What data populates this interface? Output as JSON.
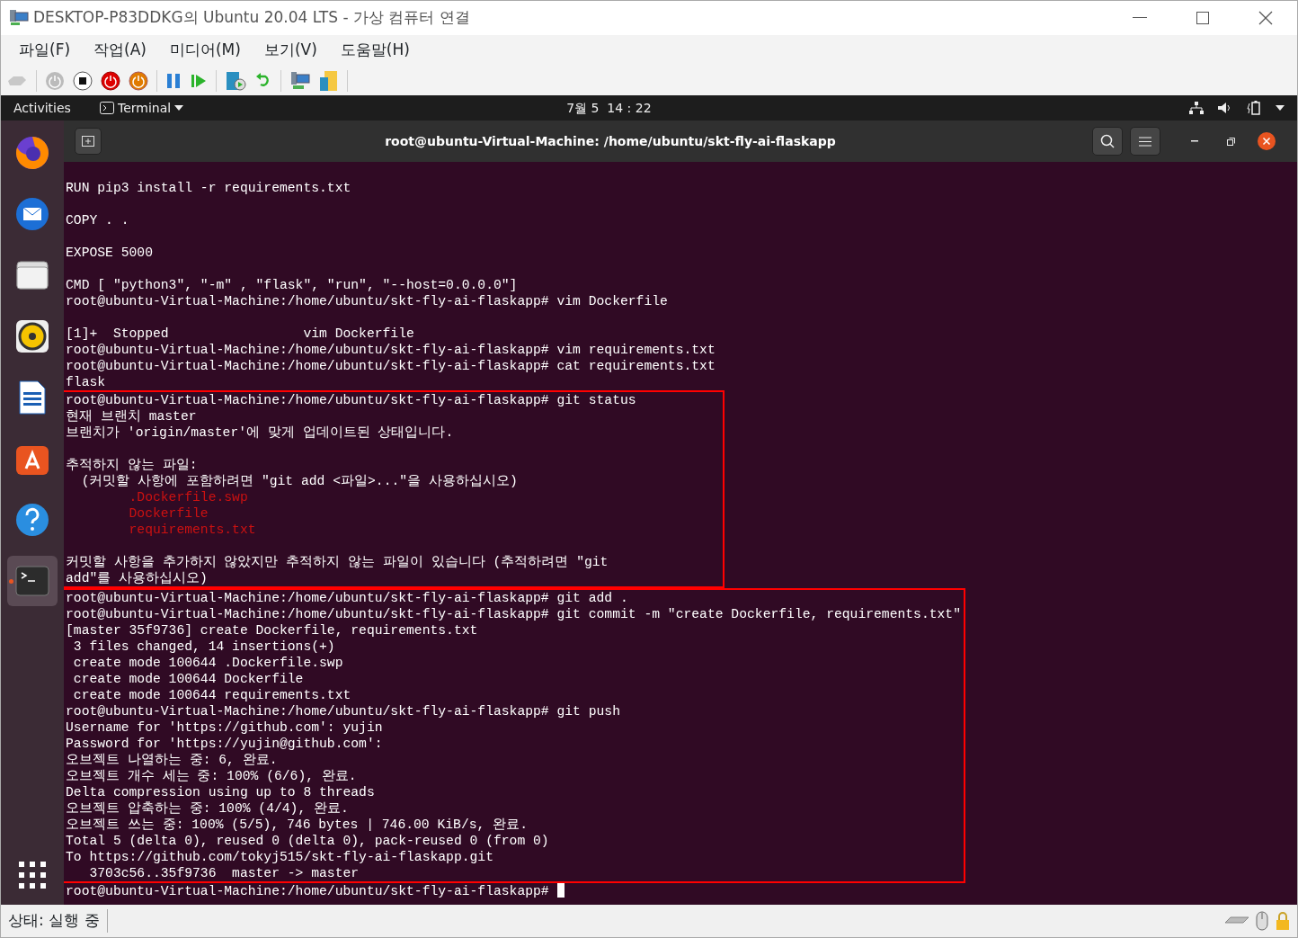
{
  "window": {
    "title": "DESKTOP-P83DDKG의 Ubuntu 20.04 LTS - 가상 컴퓨터 연결"
  },
  "menu": [
    "파일(F)",
    "작업(A)",
    "미디어(M)",
    "보기(V)",
    "도움말(H)"
  ],
  "top_bar": {
    "activities": "Activities",
    "app_menu": "Terminal",
    "clock": "7월 5  14 : 22"
  },
  "dock": [
    {
      "kind": "browser",
      "selected": false
    },
    {
      "kind": "mail",
      "selected": false
    },
    {
      "kind": "files",
      "selected": false
    },
    {
      "kind": "music",
      "selected": false
    },
    {
      "kind": "document",
      "selected": false
    },
    {
      "kind": "store",
      "selected": false
    },
    {
      "kind": "help",
      "selected": false
    },
    {
      "kind": "terminal",
      "selected": true
    }
  ],
  "terminal": {
    "title": "root@ubuntu-Virtual-Machine: /home/ubuntu/skt-fly-ai-flaskapp",
    "blocks": [
      {
        "highlighted": false,
        "lines": [
          {
            "kind": "normal",
            "text": "RUN pip3 install -r requirements.txt"
          },
          {
            "kind": "blank"
          },
          {
            "kind": "normal",
            "text": "COPY . ."
          },
          {
            "kind": "blank"
          },
          {
            "kind": "normal",
            "text": "EXPOSE 5000"
          },
          {
            "kind": "blank"
          },
          {
            "kind": "normal",
            "text": "CMD [ \"python3\", \"-m\" , \"flask\", \"run\", \"--host=0.0.0.0\"]"
          },
          {
            "kind": "normal",
            "text": "root@ubuntu-Virtual-Machine:/home/ubuntu/skt-fly-ai-flaskapp# vim Dockerfile"
          },
          {
            "kind": "blank"
          },
          {
            "kind": "normal",
            "text": "[1]+  Stopped                 vim Dockerfile"
          },
          {
            "kind": "normal",
            "text": "root@ubuntu-Virtual-Machine:/home/ubuntu/skt-fly-ai-flaskapp# vim requirements.txt"
          },
          {
            "kind": "normal",
            "text": "root@ubuntu-Virtual-Machine:/home/ubuntu/skt-fly-ai-flaskapp# cat requirements.txt"
          },
          {
            "kind": "normal",
            "text": "flask"
          }
        ]
      },
      {
        "highlighted": true,
        "lines": [
          {
            "kind": "normal",
            "text": "root@ubuntu-Virtual-Machine:/home/ubuntu/skt-fly-ai-flaskapp# git status"
          },
          {
            "kind": "normal",
            "text": "현재 브랜치 master"
          },
          {
            "kind": "normal",
            "text": "브랜치가 'origin/master'에 맞게 업데이트된 상태입니다."
          },
          {
            "kind": "blank"
          },
          {
            "kind": "normal",
            "text": "추적하지 않는 파일:"
          },
          {
            "kind": "normal",
            "text": "  (커밋할 사항에 포함하려면 \"git add <파일>...\"을 사용하십시오)"
          },
          {
            "kind": "untracked",
            "text": "        .Dockerfile.swp"
          },
          {
            "kind": "untracked",
            "text": "        Dockerfile"
          },
          {
            "kind": "untracked",
            "text": "        requirements.txt"
          },
          {
            "kind": "blank"
          },
          {
            "kind": "normal",
            "text": "커밋할 사항을 추가하지 않았지만 추적하지 않는 파일이 있습니다 (추적하려면 \"git"
          },
          {
            "kind": "normal",
            "text": "add\"를 사용하십시오)"
          }
        ]
      },
      {
        "highlighted": true,
        "lines": [
          {
            "kind": "normal",
            "text": "root@ubuntu-Virtual-Machine:/home/ubuntu/skt-fly-ai-flaskapp# git add ."
          },
          {
            "kind": "normal",
            "text": "root@ubuntu-Virtual-Machine:/home/ubuntu/skt-fly-ai-flaskapp# git commit -m \"create Dockerfile, requirements.txt\""
          },
          {
            "kind": "normal",
            "text": "[master 35f9736] create Dockerfile, requirements.txt"
          },
          {
            "kind": "normal",
            "text": " 3 files changed, 14 insertions(+)"
          },
          {
            "kind": "normal",
            "text": " create mode 100644 .Dockerfile.swp"
          },
          {
            "kind": "normal",
            "text": " create mode 100644 Dockerfile"
          },
          {
            "kind": "normal",
            "text": " create mode 100644 requirements.txt"
          },
          {
            "kind": "normal",
            "text": "root@ubuntu-Virtual-Machine:/home/ubuntu/skt-fly-ai-flaskapp# git push"
          },
          {
            "kind": "normal",
            "text": "Username for 'https://github.com': yujin"
          },
          {
            "kind": "normal",
            "text": "Password for 'https://yujin@github.com':"
          },
          {
            "kind": "normal",
            "text": "오브젝트 나열하는 중: 6, 완료."
          },
          {
            "kind": "normal",
            "text": "오브젝트 개수 세는 중: 100% (6/6), 완료."
          },
          {
            "kind": "normal",
            "text": "Delta compression using up to 8 threads"
          },
          {
            "kind": "normal",
            "text": "오브젝트 압축하는 중: 100% (4/4), 완료."
          },
          {
            "kind": "normal",
            "text": "오브젝트 쓰는 중: 100% (5/5), 746 bytes | 746.00 KiB/s, 완료."
          },
          {
            "kind": "normal",
            "text": "Total 5 (delta 0), reused 0 (delta 0), pack-reused 0 (from 0)"
          },
          {
            "kind": "normal",
            "text": "To https://github.com/tokyj515/skt-fly-ai-flaskapp.git"
          },
          {
            "kind": "normal",
            "text": "   3703c56..35f9736  master -> master"
          }
        ]
      },
      {
        "highlighted": false,
        "lines": [
          {
            "kind": "normal",
            "text": "root@ubuntu-Virtual-Machine:/home/ubuntu/skt-fly-ai-flaskapp#",
            "cursor": true
          }
        ]
      }
    ]
  },
  "status_bar": {
    "text": "상태: 실행 중"
  }
}
